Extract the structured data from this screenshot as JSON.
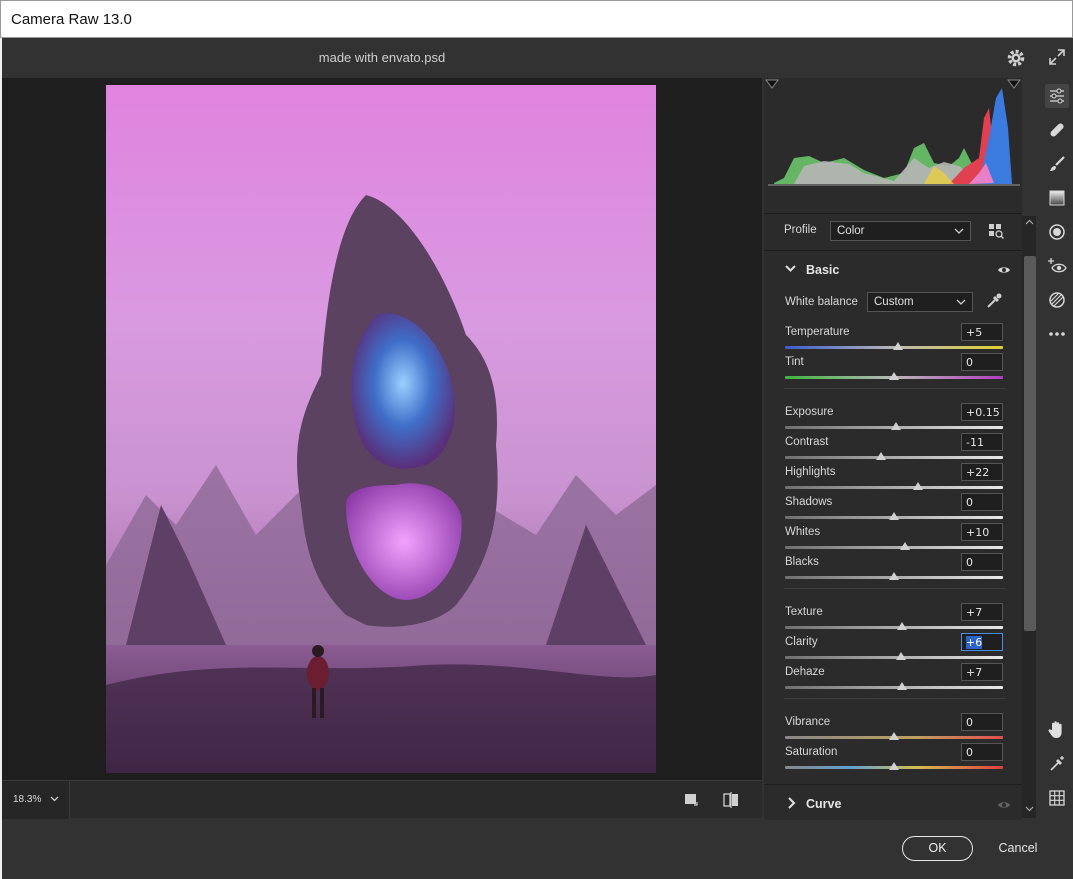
{
  "window": {
    "title": "Camera Raw 13.0"
  },
  "document": {
    "name": "made with envato.psd"
  },
  "profile": {
    "label": "Profile",
    "value": "Color"
  },
  "basic": {
    "title": "Basic",
    "white_balance": {
      "label": "White balance",
      "value": "Custom"
    },
    "sliders": [
      {
        "label": "Temperature",
        "value": "+5",
        "level": 0.52,
        "track": "temp"
      },
      {
        "label": "Tint",
        "value": "0",
        "level": 0.5,
        "track": "tint"
      },
      {
        "label": "Exposure",
        "value": "+0.15",
        "level": 0.51,
        "track": "gray"
      },
      {
        "label": "Contrast",
        "value": "-11",
        "level": 0.44,
        "track": "gray"
      },
      {
        "label": "Highlights",
        "value": "+22",
        "level": 0.61,
        "track": "gray"
      },
      {
        "label": "Shadows",
        "value": "0",
        "level": 0.5,
        "track": "gray"
      },
      {
        "label": "Whites",
        "value": "+10",
        "level": 0.55,
        "track": "gray"
      },
      {
        "label": "Blacks",
        "value": "0",
        "level": 0.5,
        "track": "gray"
      },
      {
        "label": "Texture",
        "value": "+7",
        "level": 0.535,
        "track": "gray"
      },
      {
        "label": "Clarity",
        "value": "+6",
        "level": 0.53,
        "track": "gray",
        "active": true
      },
      {
        "label": "Dehaze",
        "value": "+7",
        "level": 0.535,
        "track": "gray"
      },
      {
        "label": "Vibrance",
        "value": "0",
        "level": 0.5,
        "track": "vibrance"
      },
      {
        "label": "Saturation",
        "value": "0",
        "level": 0.5,
        "track": "saturation"
      }
    ]
  },
  "curve": {
    "title": "Curve"
  },
  "zoom": {
    "value": "18.3%"
  },
  "buttons": {
    "ok": "OK",
    "cancel": "Cancel"
  },
  "icons": [
    "gear-icon",
    "expand-icon",
    "edit-sliders-icon",
    "healing-icon",
    "brush-icon",
    "gradient-icon",
    "radial-filter-icon",
    "red-eye-icon",
    "presets-icon",
    "more-icon",
    "hand-icon",
    "sampler-icon",
    "grid-icon"
  ]
}
